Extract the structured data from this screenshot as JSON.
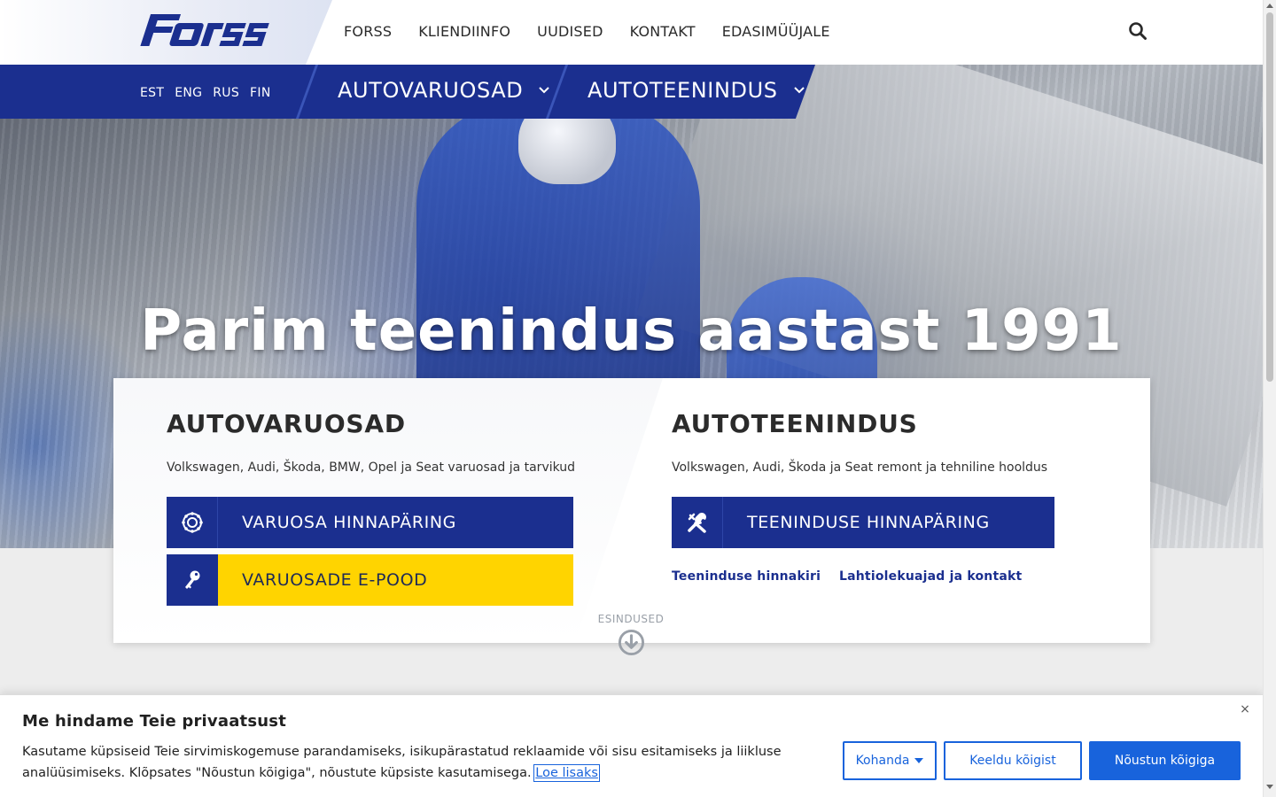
{
  "brand": {
    "logo_text": "Forss",
    "logo_color": "#1b2f8f"
  },
  "top_nav": {
    "items": [
      "FORSS",
      "KLIENDIINFO",
      "UUDISED",
      "KONTAKT",
      "EDASIMÜÜJALE"
    ],
    "search_icon": "search-icon"
  },
  "languages": [
    "EST",
    "ENG",
    "RUS",
    "FIN"
  ],
  "sub_nav": {
    "items": [
      {
        "label": "AUTOVARUOSAD"
      },
      {
        "label": "AUTOTEENINDUS"
      }
    ],
    "chevron": "ˇ"
  },
  "hero": {
    "title": "Parim teenindus aastast 1991"
  },
  "parts": {
    "title": "AUTOVARUOSAD",
    "description": "Volkswagen, Audi, Škoda, BMW, Opel ja Seat varuosad ja tarvikud",
    "buttons": [
      {
        "label": "VARUOSA HINNAPÄRING",
        "icon": "gear-wheel-icon"
      },
      {
        "label": "VARUOSADE E-POOD",
        "icon": "key-icon"
      }
    ]
  },
  "service": {
    "title": "AUTOTEENINDUS",
    "description": "Volkswagen, Audi, Škoda ja Seat remont ja tehniline hooldus",
    "button": {
      "label": "TEENINDUSE HINNAPÄRING",
      "icon": "tools-icon"
    },
    "links": [
      "Teeninduse hinnakiri",
      "Lahtiolekuajad ja kontakt"
    ]
  },
  "scroll_hint": {
    "label": "ESINDUSED",
    "icon": "arrow-down-circle-icon"
  },
  "cookie": {
    "title": "Me hindame Teie privaatsust",
    "text": "Kasutame küpsiseid Teie sirvimiskogemuse parandamiseks, isikupärastatud reklaamide või sisu esitamiseks ja liikluse analüüsimiseks. Klõpsates \"Nõustun kõigiga\", nõustute küpsiste kasutamisega. ",
    "read_more": "Loe lisaks",
    "close": "×",
    "customize": "Kohanda",
    "reject": "Keeldu kõigist",
    "accept": "Nõustun kõigiga"
  },
  "colors": {
    "brand_blue": "#1b2f8f",
    "yellow": "#ffd400",
    "cookie_blue": "#1863dc"
  }
}
